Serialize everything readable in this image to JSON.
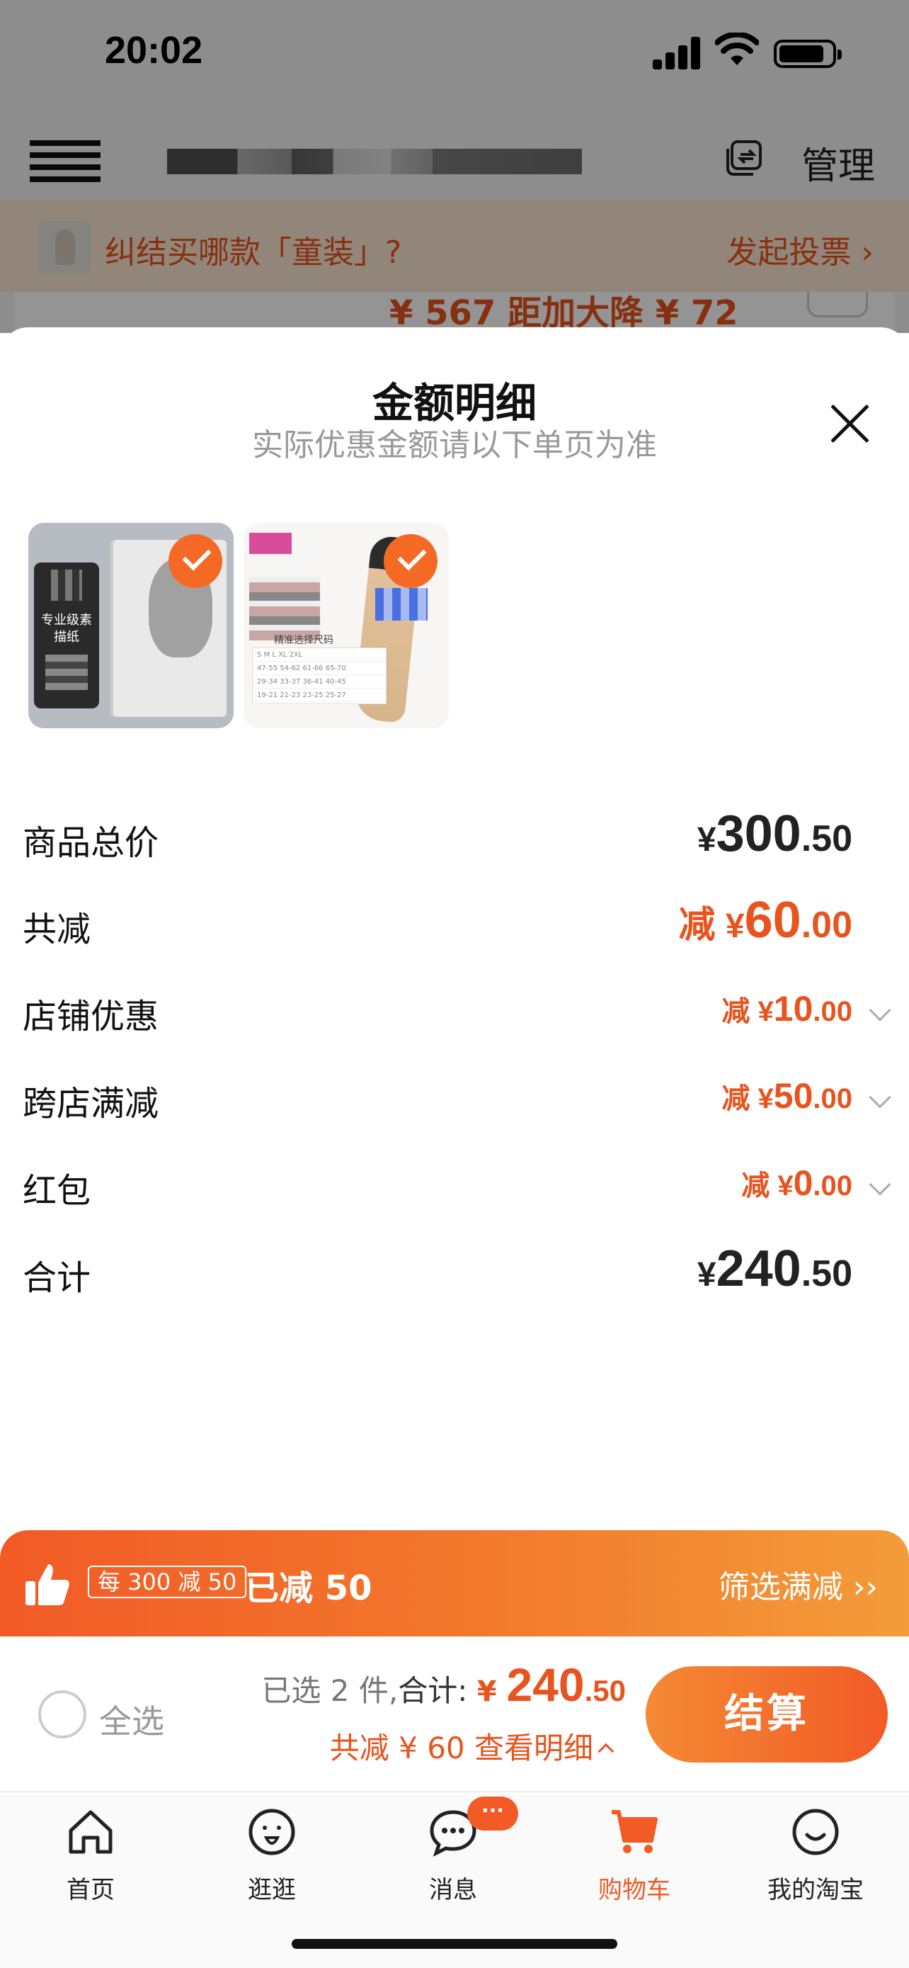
{
  "status_bar": {
    "time": "20:02"
  },
  "nav": {
    "manage": "管理"
  },
  "promo_strip": {
    "text": "纠结买哪款「童装」?",
    "vote": "发起投票 ›"
  },
  "peek": {
    "text": "¥ 567 距加大降 ¥ 72"
  },
  "sheet": {
    "title": "金额明细",
    "subtitle": "实际优惠金额请以下单页为准",
    "products": [
      {
        "label": "专业级素描纸",
        "checked": true
      },
      {
        "label": "精准选择尺码",
        "checked": true
      }
    ],
    "size_chart_rows": [
      "S  M  L  XL  2XL",
      "47-55  54-62  61-66  65-70",
      "29-34  33-37  36-41  40-45",
      "19-21  21-23  23-25  25-27"
    ],
    "lines": [
      {
        "label": "商品总价",
        "prefix": "",
        "yen": "¥",
        "int": "300",
        "dec": ".50",
        "color": "#222222",
        "expandable": false
      },
      {
        "label": "共减",
        "prefix": "减 ",
        "yen": "¥",
        "int": "60",
        "dec": ".00",
        "color": "#e8541e",
        "expandable": false
      },
      {
        "label": "店铺优惠",
        "prefix": "减 ",
        "yen": "¥",
        "int": "10",
        "dec": ".00",
        "color": "#e8541e",
        "expandable": true
      },
      {
        "label": "跨店满减",
        "prefix": "减 ",
        "yen": "¥",
        "int": "50",
        "dec": ".00",
        "color": "#e8541e",
        "expandable": true
      },
      {
        "label": "红包",
        "prefix": "减 ",
        "yen": "¥",
        "int": "0",
        "dec": ".00",
        "color": "#e8541e",
        "expandable": true
      },
      {
        "label": "合计",
        "prefix": "",
        "yen": "¥",
        "int": "240",
        "dec": ".50",
        "color": "#222222",
        "expandable": false
      }
    ]
  },
  "promo_bar": {
    "tag": "每 300 减 50",
    "saved": "已减 50",
    "filter": "筛选满减 ››"
  },
  "checkout": {
    "select_all": "全选",
    "selected": "已选 2 件,",
    "total_label": "合计: ",
    "yen": "¥ ",
    "total_int": "240",
    "total_dec": ".50",
    "discount": "共减 ¥ 60  查看明细",
    "button": "结算"
  },
  "tabs": [
    {
      "label": "首页",
      "icon": "home-icon",
      "active": false
    },
    {
      "label": "逛逛",
      "icon": "browse-icon",
      "active": false
    },
    {
      "label": "消息",
      "icon": "message-icon",
      "active": false,
      "badge": "···"
    },
    {
      "label": "购物车",
      "icon": "cart-icon",
      "active": true
    },
    {
      "label": "我的淘宝",
      "icon": "profile-icon",
      "active": false
    }
  ],
  "colors": {
    "accent": "#f25a26",
    "price_orange": "#e8541e",
    "promo_strip": "#fbe7d3"
  }
}
